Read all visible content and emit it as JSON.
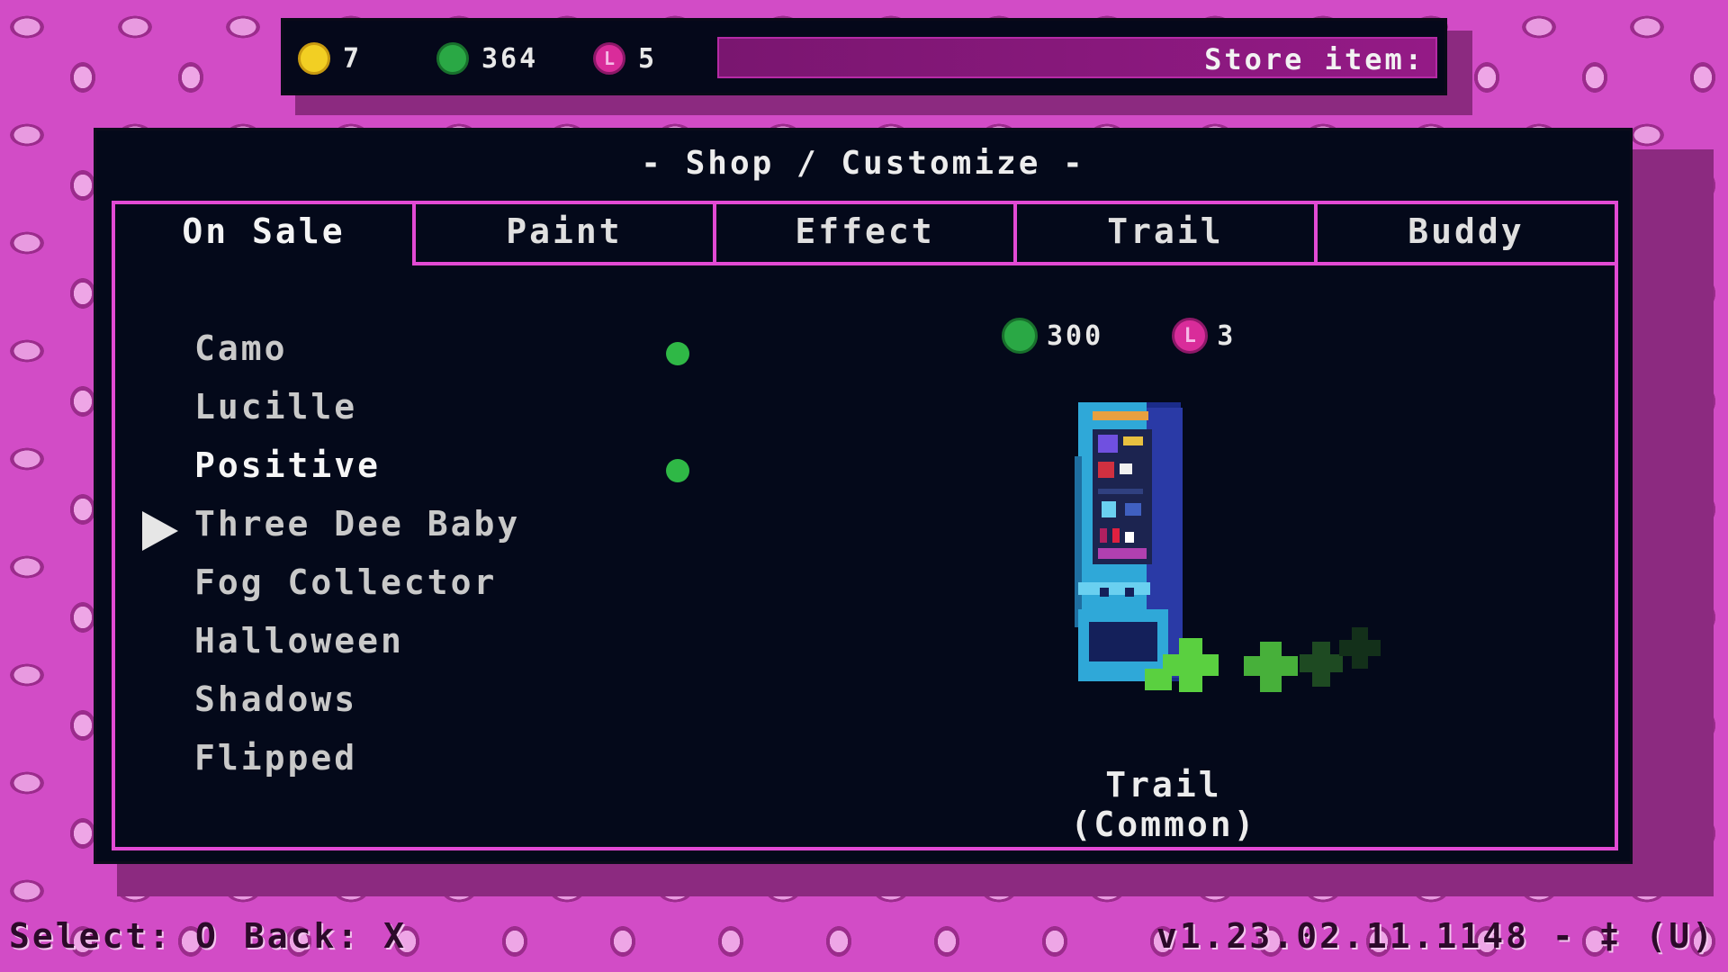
{
  "hud": {
    "currencies": [
      {
        "name": "gold-coin",
        "glyph": "",
        "value": "7",
        "color": "#f2cf23"
      },
      {
        "name": "green-coin",
        "glyph": "",
        "value": "364",
        "color": "#2aa845"
      },
      {
        "name": "pink-coin",
        "glyph": "L",
        "value": "5",
        "color": "#d92c9a"
      }
    ],
    "store_label": "Store item:"
  },
  "panel": {
    "title": "- Shop / Customize -",
    "tabs": [
      "On Sale",
      "Paint",
      "Effect",
      "Trail",
      "Buddy"
    ],
    "active_tab": "On Sale"
  },
  "items": [
    {
      "label": "Camo",
      "owned_dot": true
    },
    {
      "label": "Lucille",
      "owned_dot": false
    },
    {
      "label": "Positive",
      "owned_dot": true,
      "selected": true
    },
    {
      "label": "Three Dee Baby",
      "owned_dot": false
    },
    {
      "label": "Fog Collector",
      "owned_dot": false
    },
    {
      "label": "Halloween",
      "owned_dot": false
    },
    {
      "label": "Shadows",
      "owned_dot": false
    },
    {
      "label": "Flipped",
      "owned_dot": false
    }
  ],
  "preview": {
    "prices": [
      {
        "coin": "green-coin",
        "glyph": "",
        "value": "300"
      },
      {
        "coin": "pink-coin",
        "glyph": "L",
        "value": "3"
      }
    ],
    "caption": "Trail (Common)"
  },
  "footer": {
    "select": "Select: O",
    "back": "Back: X",
    "version": "v1.23.02.11.1148 - ‡ (U)"
  },
  "colors": {
    "accent": "#e24ad4",
    "panel_bg": "#04091a",
    "owned_dot": "#2fb846",
    "background": "#d24cc6"
  }
}
